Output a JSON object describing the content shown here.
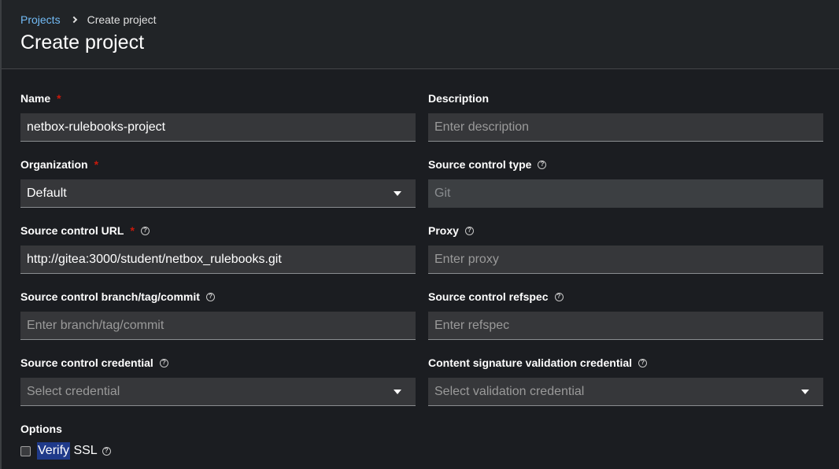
{
  "breadcrumb": {
    "parent": "Projects",
    "current": "Create project"
  },
  "page_title": "Create project",
  "fields": {
    "name": {
      "label": "Name",
      "value": "netbox-rulebooks-project"
    },
    "description": {
      "label": "Description",
      "placeholder": "Enter description"
    },
    "organization": {
      "label": "Organization",
      "value": "Default"
    },
    "source_control_type": {
      "label": "Source control type",
      "value": "Git"
    },
    "source_control_url": {
      "label": "Source control URL",
      "value": "http://gitea:3000/student/netbox_rulebooks.git"
    },
    "proxy": {
      "label": "Proxy",
      "placeholder": "Enter proxy"
    },
    "branch": {
      "label": "Source control branch/tag/commit",
      "placeholder": "Enter branch/tag/commit"
    },
    "refspec": {
      "label": "Source control refspec",
      "placeholder": "Enter refspec"
    },
    "credential": {
      "label": "Source control credential",
      "placeholder": "Select credential"
    },
    "signature_credential": {
      "label": "Content signature validation credential",
      "placeholder": "Select validation credential"
    }
  },
  "options": {
    "label": "Options",
    "verify_ssl": {
      "highlight": "Verify",
      "rest": " SSL"
    }
  },
  "required_mark": "*",
  "help_glyph": "?",
  "colors": {
    "link": "#73bcf7",
    "required": "#c9190b",
    "highlight": "#1f3a8a"
  }
}
